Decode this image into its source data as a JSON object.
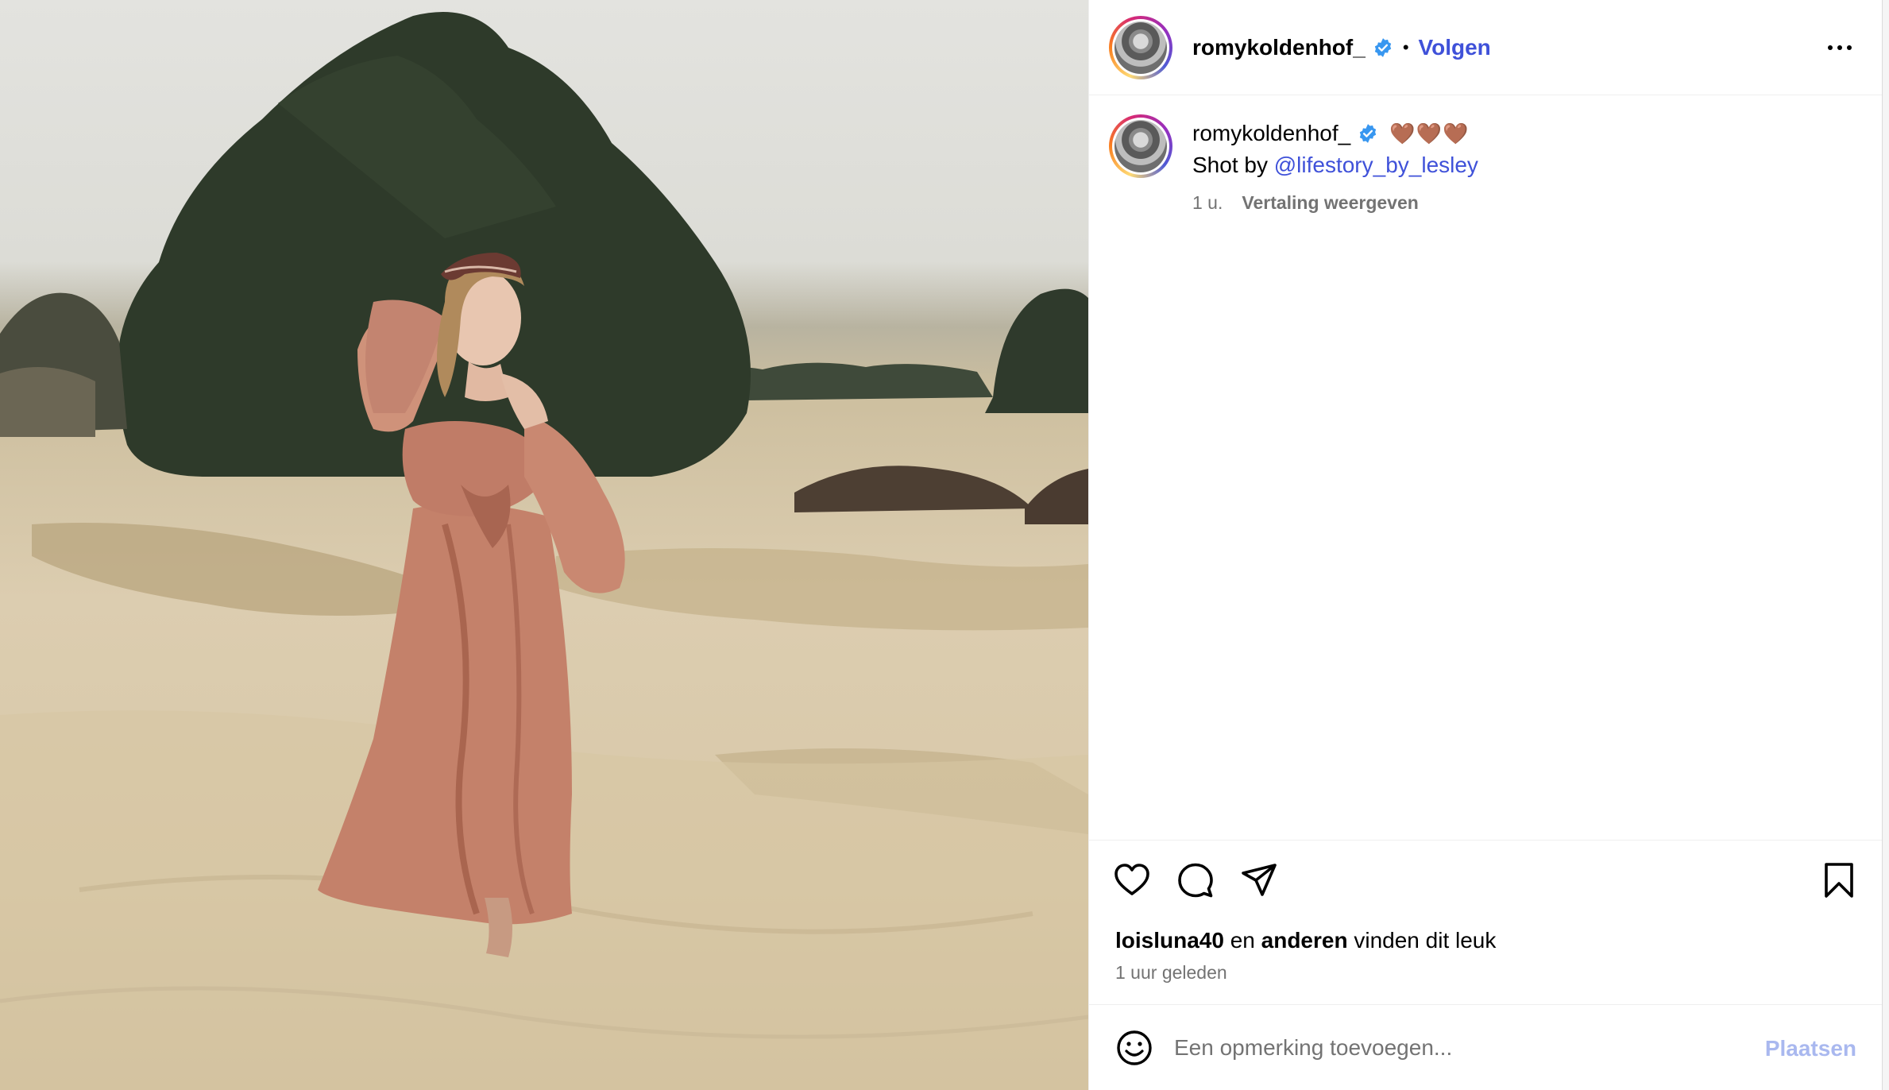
{
  "post": {
    "author": "romykoldenhof_",
    "follow_label": "Volgen",
    "separator": "•",
    "more_label": "…"
  },
  "caption": {
    "author": "romykoldenhof_",
    "emojis": "🤎🤎🤎",
    "prefix": "Shot by ",
    "mention": "@lifestory_by_lesley",
    "age": "1 u.",
    "translate_label": "Vertaling weergeven"
  },
  "engagement": {
    "liker": "loisluna40",
    "joiner": " en ",
    "others": "anderen",
    "suffix": " vinden dit leuk",
    "time": "1 uur geleden"
  },
  "comment": {
    "placeholder": "Een opmerking toevoegen...",
    "post_label": "Plaatsen"
  },
  "colors": {
    "link": "#3f51d9",
    "verified": "#3897f0",
    "secondary_text": "#737373",
    "post_disabled": "#a9b8ef"
  },
  "icons": {
    "like": "heart-icon",
    "comment": "comment-bubble-icon",
    "share": "paper-plane-icon",
    "save": "bookmark-icon",
    "emoji": "smiley-icon",
    "more": "more-options-icon"
  }
}
